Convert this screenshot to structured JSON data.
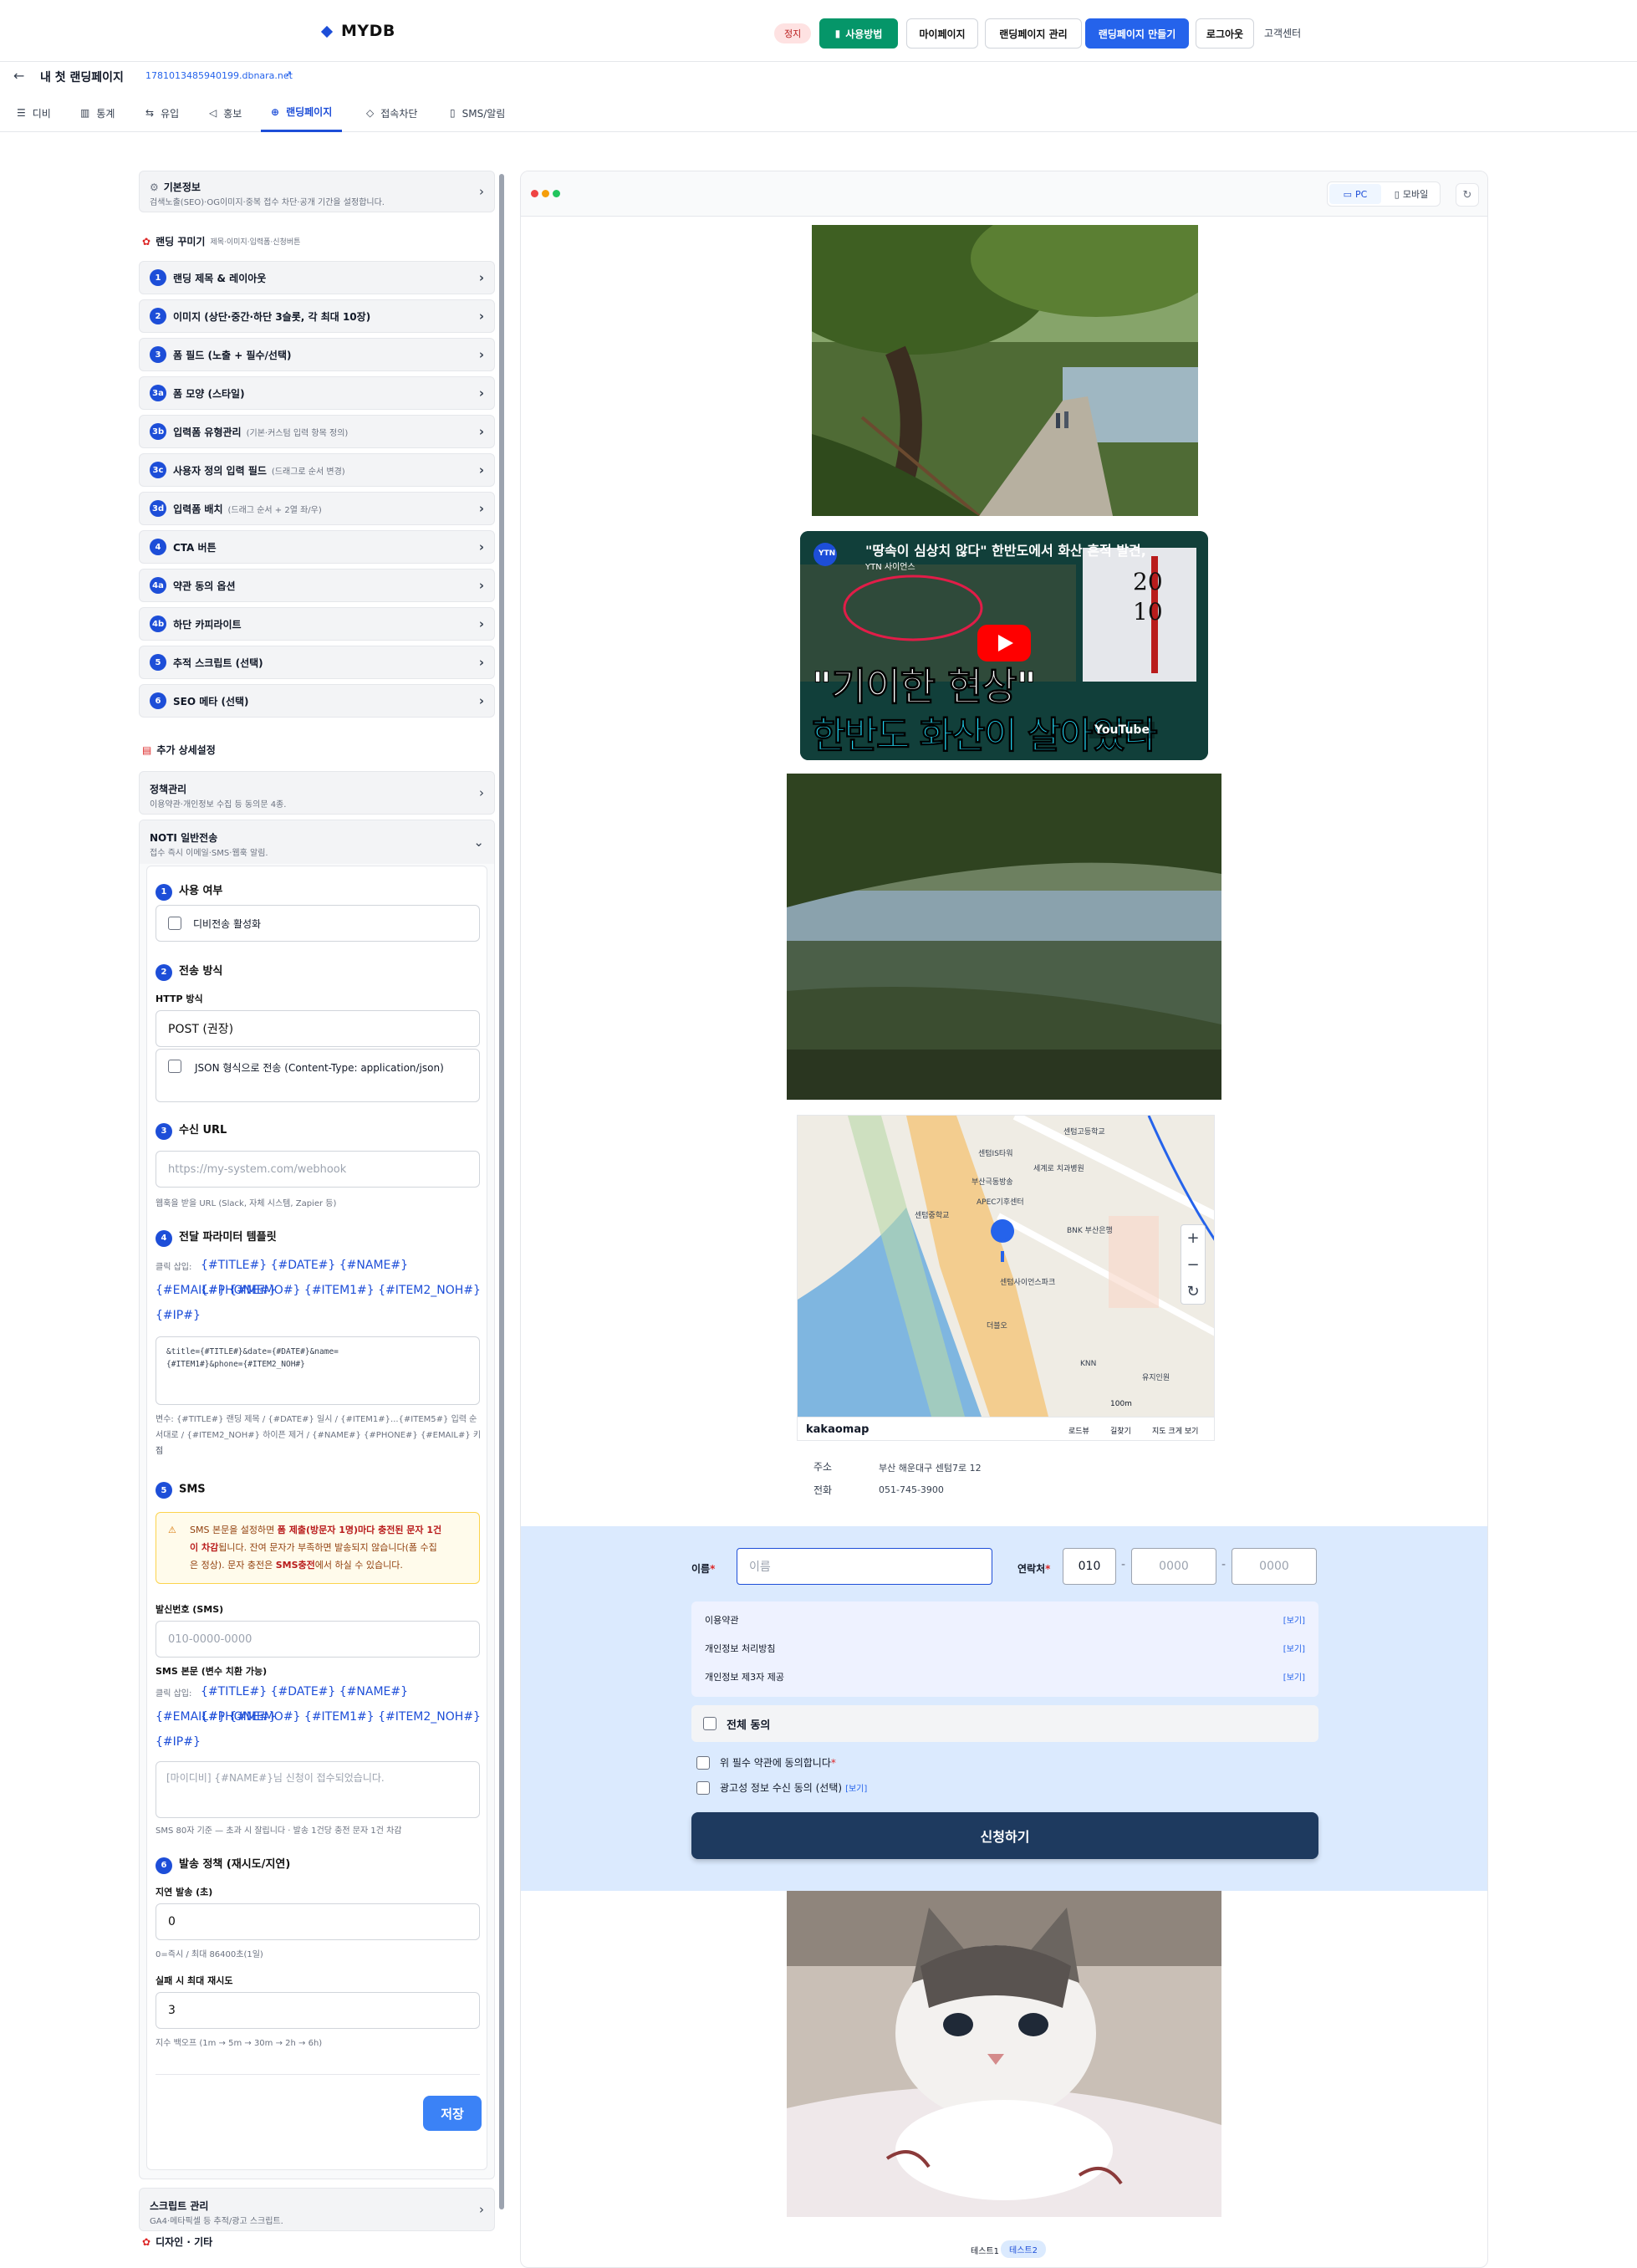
{
  "topnav": {
    "logo": "MYDB",
    "stop_badge": "정지",
    "guide_btn": "사용방법",
    "mypage_btn": "마이페이지",
    "manage_btn": "랜딩페이지 관리",
    "create_btn": "랜딩페이지 만들기",
    "logout_btn": "로그아웃",
    "support_link": "고객센터"
  },
  "page": {
    "title": "내 첫 랜딩페이지",
    "url": "1781013485940199.dbnara.net"
  },
  "tabs": [
    "디비",
    "통계",
    "유입",
    "홍보",
    "랜딩페이지",
    "접속차단",
    "SMS/알림"
  ],
  "left": {
    "basic": {
      "title": "기본정보",
      "desc": "검색노출(SEO)·OG이미지·중복 접수 차단·공개 기간을 설정합니다."
    },
    "decorate": {
      "title": "랜딩 꾸미기",
      "desc": "제목·이미지·입력폼·신청버튼"
    },
    "steps": [
      {
        "num": "1",
        "label": "랜딩 제목 & 레이아웃",
        "sub": ""
      },
      {
        "num": "2",
        "label": "이미지 (상단·중간·하단 3슬롯, 각 최대 10장)",
        "sub": ""
      },
      {
        "num": "3",
        "label": "폼 필드 (노출 + 필수/선택)",
        "sub": ""
      },
      {
        "num": "3a",
        "label": "폼 모양 (스타일)",
        "sub": ""
      },
      {
        "num": "3b",
        "label": "입력폼 유형관리",
        "sub": "(기본·커스텀 입력 항목 정의)"
      },
      {
        "num": "3c",
        "label": "사용자 정의 입력 필드",
        "sub": "(드래그로 순서 변경)"
      },
      {
        "num": "3d",
        "label": "입력폼 배치",
        "sub": "(드래그 순서 + 2열 좌/우)"
      },
      {
        "num": "4",
        "label": "CTA 버튼",
        "sub": ""
      },
      {
        "num": "4a",
        "label": "약관 동의 옵션",
        "sub": ""
      },
      {
        "num": "4b",
        "label": "하단 카피라이트",
        "sub": ""
      },
      {
        "num": "5",
        "label": "추적 스크립트 (선택)",
        "sub": ""
      },
      {
        "num": "6",
        "label": "SEO 메타 (선택)",
        "sub": ""
      }
    ],
    "extra": {
      "title": "추가 상세설정"
    },
    "policy": {
      "title": "정책관리",
      "desc": "이용약관·개인정보 수집 등 동의문 4종."
    },
    "noti": {
      "title": "NOTI 일반전송",
      "desc": "접수 즉시 이메일·SMS·웹훅 알림."
    },
    "s1": {
      "num": "1",
      "title": "사용 여부",
      "checkbox": "디비전송 활성화"
    },
    "s2": {
      "num": "2",
      "title": "전송 방식",
      "method_label": "HTTP 방식",
      "method_value": "POST (권장)",
      "json_checkbox": "JSON 형식으로 전송 (Content-Type: application/json)"
    },
    "s3": {
      "num": "3",
      "title": "수신 URL",
      "placeholder": "https://my-system.com/webhook",
      "hint": "웹훅을 받을 URL (Slack, 자체 시스템, Zapier 등)"
    },
    "s4": {
      "num": "4",
      "title": "전달 파라미터 템플릿",
      "click_label": "클릭 삽입:",
      "tokens1": "{#TITLE#}  {#DATE#}  {#NAME#}  {#PHONE#}",
      "tokens2": "{#EMAIL#}  {#MEMO#}  {#ITEM1#}  {#ITEM2_NOH#}",
      "tokens3": "{#IP#}",
      "template_line1": "&title={#TITLE#}&date={#DATE#}&name=",
      "template_line2": "{#ITEM1#}&phone={#ITEM2_NOH#}",
      "hint1": "변수: {#TITLE#} 랜딩 제목 / {#DATE#} 일시 / {#ITEM1#}...{#ITEM5#} 입력 순",
      "hint2": "서대로 / {#ITEM2_NOH#} 하이픈 제거 / {#NAME#} {#PHONE#} {#EMAIL#} 키 직",
      "hint3": "접"
    },
    "s5": {
      "num": "5",
      "title": "SMS",
      "warn1a": "SMS 본문을 설정하면 ",
      "warn1b": "폼 제출(방문자 1명)마다 충전된 문자 1건",
      "warn2a": "이 차감",
      "warn2b": "됩니다. 잔여 문자가 부족하면 발송되지 않습니다(폼 수집",
      "warn3a": "은 정상). 문자 충전은 ",
      "warn3b": "SMS충전",
      "warn3c": "에서 하실 수 있습니다.",
      "sender_label": "발신번호 (SMS)",
      "sender_placeholder": "010-0000-0000",
      "body_label": "SMS 본문 (변수 치환 가능)",
      "click_label": "클릭 삽입:",
      "tokens1": "{#TITLE#}  {#DATE#}  {#NAME#}  {#PHONE#}",
      "tokens2": "{#EMAIL#}  {#MEMO#}  {#ITEM1#}  {#ITEM2_NOH#}",
      "tokens3": "{#IP#}",
      "body_placeholder": "[마이디비] {#NAME#}님 신청이 접수되었습니다.",
      "hint": "SMS 80자 기준 — 초과 시 잘립니다 · 발송 1건당 충전 문자 1건 차감"
    },
    "s6": {
      "num": "6",
      "title": "발송 정책 (재시도/지연)",
      "delay_label": "지연 발송 (초)",
      "delay_value": "0",
      "delay_hint": "0=즉시 / 최대 86400초(1일)",
      "retry_label": "실패 시 최대 재시도",
      "retry_value": "3",
      "retry_hint": "지수 백오프 (1m → 5m → 30m → 2h → 6h)"
    },
    "save_btn": "저장",
    "script": {
      "title": "스크립트 관리",
      "desc": "GA4·메타픽셀 등 추적/광고 스크립트."
    },
    "design": {
      "title": "디자인 · 기타"
    }
  },
  "preview": {
    "pc_btn": "PC",
    "mobile_btn": "모바일",
    "video": {
      "title": "\"땅속이 심상치 않다\" 한반도에서 화산 흔적 발견,",
      "channel": "YTN 사이언스",
      "big1": "\"기이한 현상\"",
      "big2": "한반도 화산이 살아있다",
      "thermo1": "20",
      "thermo2": "10",
      "watch": "YouTube"
    },
    "map": {
      "brand": "kakaomap",
      "links": [
        "로드뷰",
        "길찾기",
        "지도 크게 보기"
      ],
      "scale": "100m",
      "labels": [
        "APEC기후센터",
        "센텀중학교",
        "센텀고등학교",
        "BNK 부산은행",
        "세계로 치과병원",
        "부산극동방송",
        "센텀사이언스파크",
        "KNN",
        "더블오",
        "유지인원",
        "센텀IS타워"
      ]
    },
    "address_label": "주소",
    "address_value": "부산 해운대구 센텀7로 12",
    "phone_label": "전화",
    "phone_value": "051-745-3900",
    "form": {
      "name_label": "이름",
      "name_placeholder": "이름",
      "phone_label": "연락처",
      "phone1": "010",
      "phone2": "0000",
      "phone3": "0000",
      "terms": [
        {
          "label": "이용약관",
          "link": "[보기]"
        },
        {
          "label": "개인정보 처리방침",
          "link": "[보기]"
        },
        {
          "label": "개인정보 제3자 제공",
          "link": "[보기]"
        }
      ],
      "all_agree": "전체 동의",
      "agree_required": "위 필수 약관에 동의합니다",
      "agree_marketing": "광고성 정보 수신 동의 (선택)",
      "marketing_link": "[보기]",
      "submit": "신청하기"
    },
    "footer_tabs": [
      "테스트1",
      "테스트2"
    ]
  },
  "colors": {
    "primary": "#1d4ed8",
    "green": "#059669",
    "navy": "#1e3a5f",
    "formbg": "#dbeafe"
  }
}
